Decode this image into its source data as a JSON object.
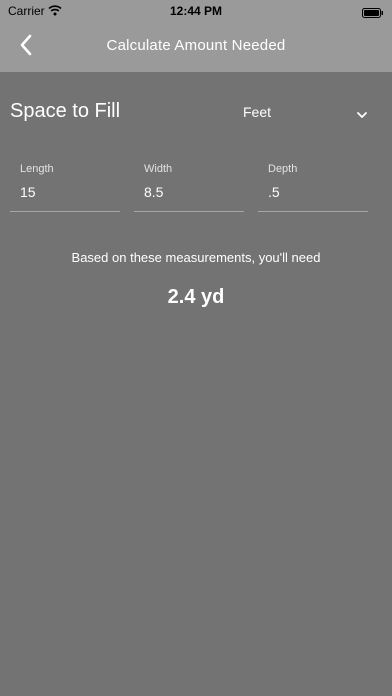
{
  "status_bar": {
    "carrier": "Carrier",
    "time": "12:44 PM"
  },
  "nav": {
    "title": "Calculate Amount Needed"
  },
  "form": {
    "section_title": "Space to Fill",
    "unit": "Feet",
    "fields": [
      {
        "label": "Length",
        "value": "15"
      },
      {
        "label": "Width",
        "value": "8.5"
      },
      {
        "label": "Depth",
        "value": ".5"
      }
    ]
  },
  "result": {
    "caption": "Based on these measurements, you'll need",
    "value": "2.4 yd"
  },
  "colors": {
    "background": "#737373",
    "bar": "#9a9a9a",
    "text": "#ffffff"
  }
}
